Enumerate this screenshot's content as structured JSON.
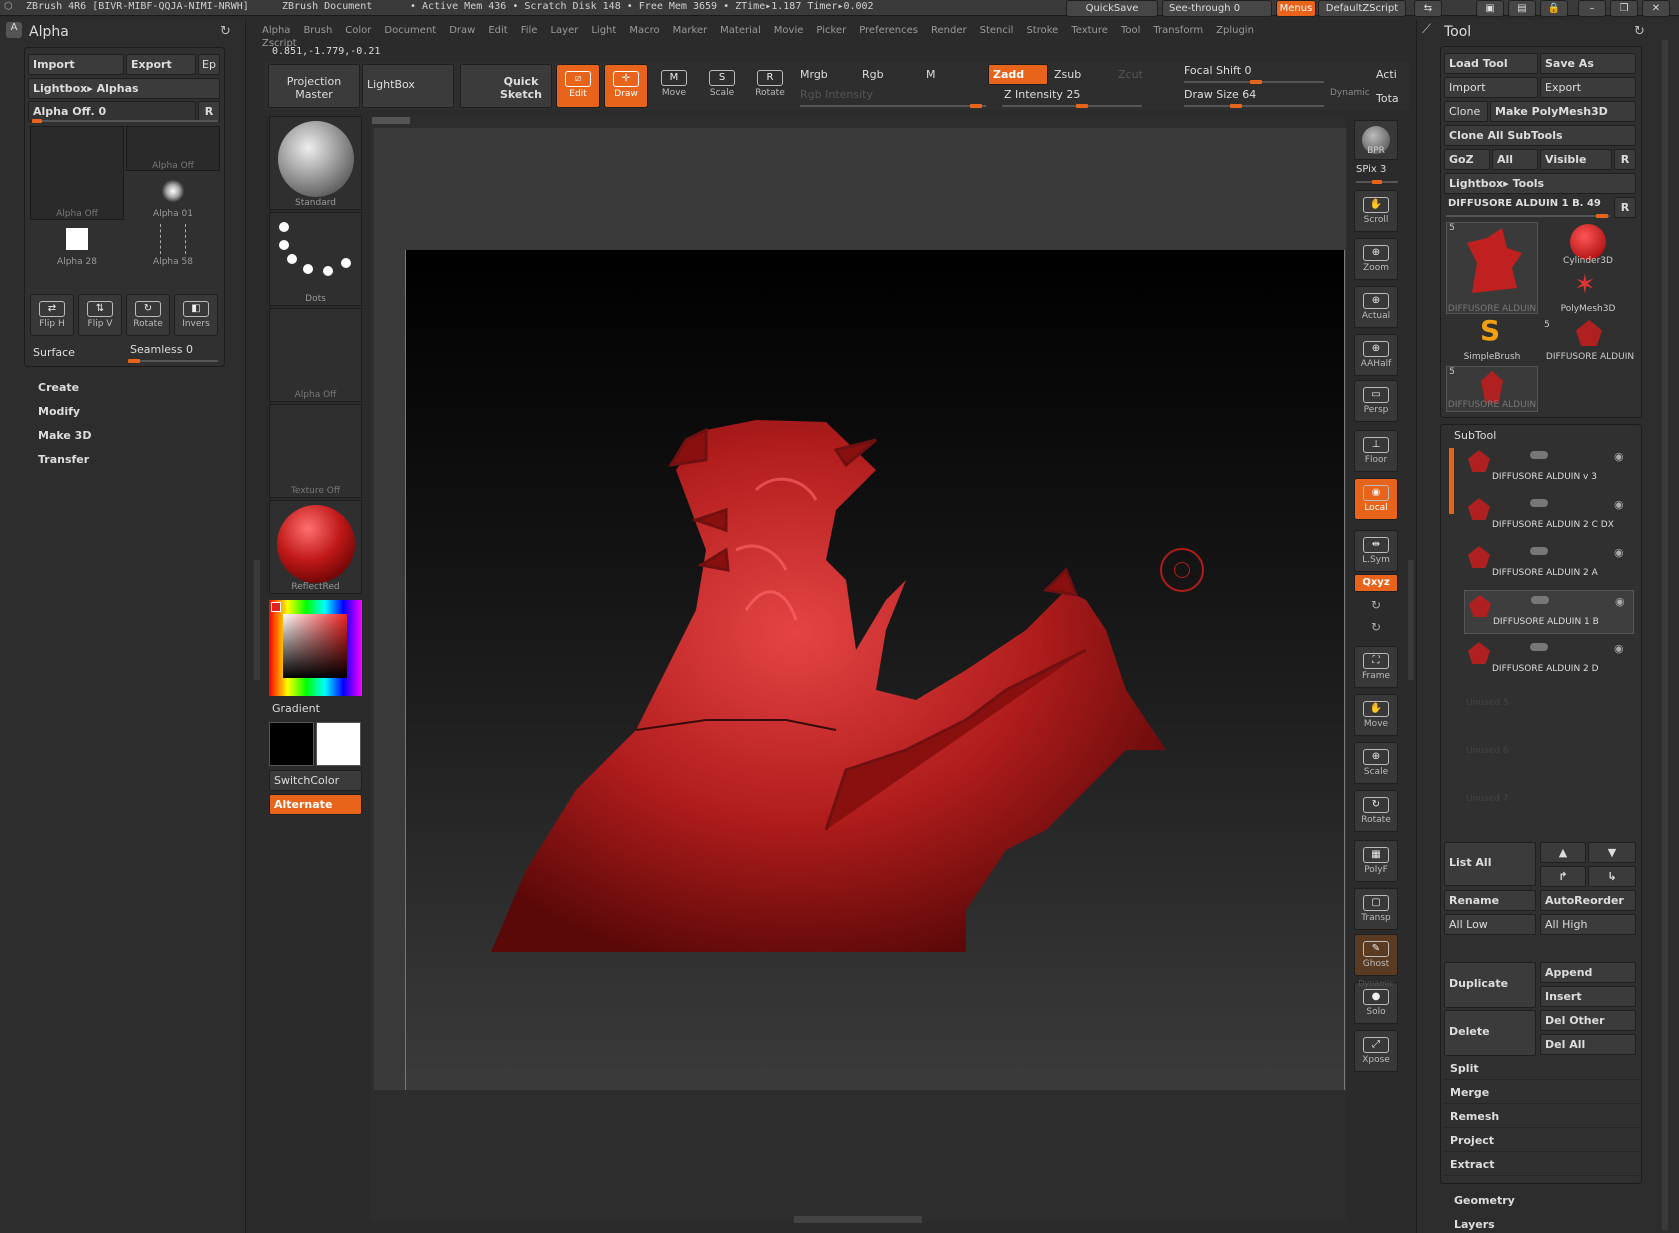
{
  "titlebar": {
    "app": "ZBrush 4R6 [BIVR-MIBF-QQJA-NIMI-NRWH]",
    "document": "ZBrush Document",
    "stats": "• Active Mem 436 • Scratch Disk 148 • Free Mem 3659 • ZTime▸1.187 Timer▸0.002",
    "quicksave": "QuickSave",
    "seethrough": "See-through  0",
    "menus": "Menus",
    "defaultzscript": "DefaultZScript"
  },
  "menubar": [
    "Alpha",
    "Brush",
    "Color",
    "Document",
    "Draw",
    "Edit",
    "File",
    "Layer",
    "Light",
    "Macro",
    "Marker",
    "Material",
    "Movie",
    "Picker",
    "Preferences",
    "Render",
    "Stencil",
    "Stroke",
    "Texture",
    "Tool",
    "Transform",
    "Zplugin",
    "Zscript"
  ],
  "coords": "0.851,-1.779,-0.21",
  "alpha_panel": {
    "title": "Alpha",
    "import": "Import",
    "export": "Export",
    "ep": "Ep",
    "lightbox": "Lightbox▸ Alphas",
    "alpha_off": "Alpha  Off. 0",
    "r": "R",
    "thumbs": [
      "Alpha  Off",
      "Alpha  Off",
      "Alpha  01",
      "Alpha  28",
      "Alpha  58"
    ],
    "tools": [
      "Flip H",
      "Flip V",
      "Rotate",
      "Invers"
    ],
    "surface": "Surface",
    "seamless": "Seamless 0",
    "menu": [
      "Create",
      "Modify",
      "Make 3D",
      "Transfer"
    ]
  },
  "toolbar": {
    "projection_master": "Projection Master",
    "lightbox": "LightBox",
    "quick_sketch": "Quick Sketch",
    "edit": "Edit",
    "draw": "Draw",
    "move": "Move",
    "scale": "Scale",
    "rotate": "Rotate",
    "mrgb": "Mrgb",
    "rgb": "Rgb",
    "m": "M",
    "zadd": "Zadd",
    "zsub": "Zsub",
    "zcut": "Zcut",
    "rgb_intensity": "Rgb  Intensity",
    "z_intensity": "Z  Intensity 25",
    "focal_shift": "Focal Shift 0",
    "draw_size": "Draw Size 64",
    "dynamic": "Dynamic",
    "acti": "Acti",
    "tota": "Tota"
  },
  "left_shelf": {
    "brush": "Standard",
    "stroke": "Dots",
    "alpha": "Alpha  Off",
    "texture": "Texture  Off",
    "material": "ReflectRed",
    "gradient": "Gradient",
    "switchcolor": "SwitchColor",
    "alternate": "Alternate"
  },
  "right_shelf": {
    "bpr": "BPR",
    "spix": "SPix 3",
    "tools": [
      "Scroll",
      "Zoom",
      "Actual",
      "AAHalf",
      "Persp",
      "Floor",
      "Local",
      "L.Sym",
      "Frame",
      "Move",
      "Scale",
      "Rotate",
      "PolyF",
      "Transp",
      "Ghost",
      "Solo",
      "Xpose"
    ],
    "xyz": "Qxyz",
    "dynamic": "Dynamic"
  },
  "tool_panel": {
    "title": "Tool",
    "load_tool": "Load Tool",
    "save_as": "Save As",
    "import": "Import",
    "export": "Export",
    "clone": "Clone",
    "make_polymesh": "Make PolyMesh3D",
    "clone_all": "Clone  All  SubTools",
    "goz": "GoZ",
    "all": "All",
    "visible": "Visible",
    "r": "R",
    "lightbox_tools": "Lightbox▸ Tools",
    "current_tool": "DIFFUSORE  ALDUIN  1  B. 49",
    "r2": "R",
    "tool_thumbs": [
      "DIFFUSORE  ALDUIN",
      "Cylinder3D",
      "PolyMesh3D",
      "SimpleBrush",
      "DIFFUSORE  ALDUIN",
      "DIFFUSORE  ALDUIN"
    ],
    "badge": "5",
    "subtool_title": "SubTool",
    "subtools": [
      "DIFFUSORE  ALDUIN  v  3",
      "DIFFUSORE  ALDUIN  2  C  DX",
      "DIFFUSORE  ALDUIN  2  A",
      "DIFFUSORE  ALDUIN  1  B",
      "DIFFUSORE  ALDUIN  2  D"
    ],
    "unused": [
      "Unused  5",
      "Unused  6",
      "Unused  7"
    ],
    "list_all": "List  All",
    "rename": "Rename",
    "autoreorder": "AutoReorder",
    "all_low": "All  Low",
    "all_high": "All  High",
    "duplicate": "Duplicate",
    "append": "Append",
    "insert": "Insert",
    "delete": "Delete",
    "del_other": "Del  Other",
    "del_all": "Del  All",
    "actions": [
      "Split",
      "Merge",
      "Remesh",
      "Project",
      "Extract"
    ],
    "geometry": "Geometry",
    "layers": "Layers"
  }
}
